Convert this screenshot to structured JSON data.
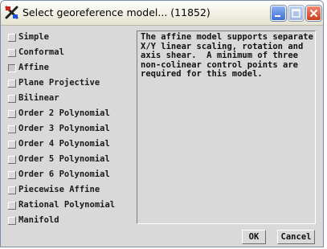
{
  "window": {
    "title": "Select georeference model... (11852)",
    "title_icon": "georeference-app-icon",
    "controls": [
      "minimize-icon",
      "maximize-icon",
      "close-icon"
    ]
  },
  "models": [
    {
      "label": "Simple",
      "selected": false
    },
    {
      "label": "Conformal",
      "selected": false
    },
    {
      "label": "Affine",
      "selected": true
    },
    {
      "label": "Plane Projective",
      "selected": false
    },
    {
      "label": "Bilinear",
      "selected": false
    },
    {
      "label": "Order 2 Polynomial",
      "selected": false
    },
    {
      "label": "Order 3 Polynomial",
      "selected": false
    },
    {
      "label": "Order 4 Polynomial",
      "selected": false
    },
    {
      "label": "Order 5 Polynomial",
      "selected": false
    },
    {
      "label": "Order 6 Polynomial",
      "selected": false
    },
    {
      "label": "Piecewise Affine",
      "selected": false
    },
    {
      "label": "Rational Polynomial",
      "selected": false
    },
    {
      "label": "Manifold",
      "selected": false
    }
  ],
  "description": "The affine model supports separate\nX/Y linear scaling, rotation and\naxis shear.  A minimum of three\nnon-colinear control points are\nrequired for this model.",
  "buttons": {
    "ok": "OK",
    "cancel": "Cancel"
  },
  "colors": {
    "dialog_bg": "#d9d9d9",
    "close_button": "#c8401e",
    "minimize_button": "#3e6ed6"
  }
}
